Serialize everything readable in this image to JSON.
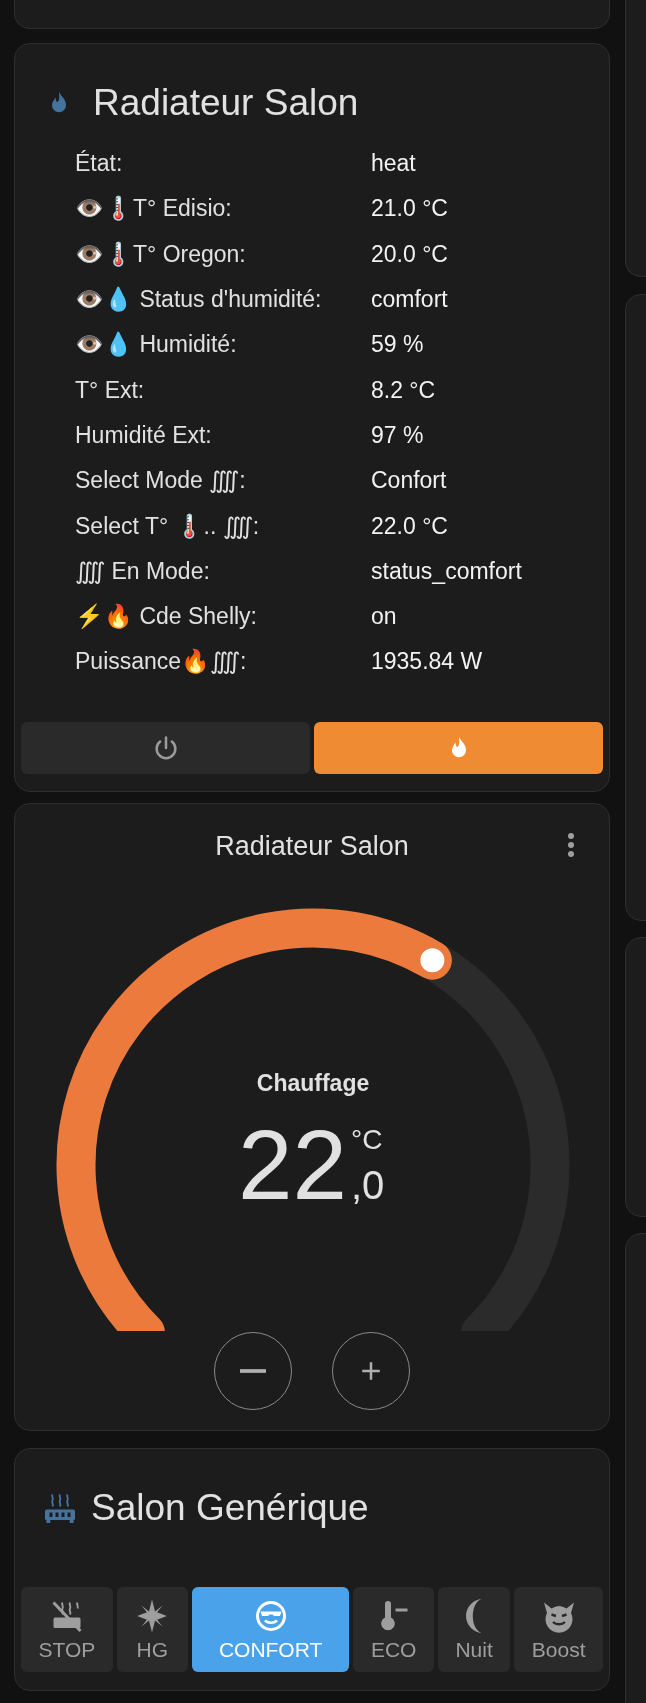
{
  "info_card": {
    "title": "Radiateur Salon",
    "rows": [
      {
        "label": "État:",
        "value": "heat"
      },
      {
        "label": "👁️🌡️T° Edisio:",
        "value": "21.0 °C"
      },
      {
        "label": "👁️🌡️T° Oregon:",
        "value": "20.0 °C"
      },
      {
        "label": "👁️💧 Status d'humidité:",
        "value": "comfort"
      },
      {
        "label": "👁️💧 Humidité:",
        "value": "59 %"
      },
      {
        "label": "T° Ext:",
        "value": "8.2 °C"
      },
      {
        "label": "Humidité Ext:",
        "value": "97 %"
      },
      {
        "label": "Select Mode ⨌:",
        "value": "Confort"
      },
      {
        "label": "Select T° 🌡️.. ⨌:",
        "value": "22.0 °C"
      },
      {
        "label": "⨌ En Mode:",
        "value": "status_comfort"
      },
      {
        "label": "⚡🔥 Cde Shelly:",
        "value": "on"
      },
      {
        "label": "Puissance🔥⨌:",
        "value": "1935.84 W"
      }
    ],
    "hvac_buttons": [
      {
        "kind": "off",
        "selected": false
      },
      {
        "kind": "heat",
        "selected": true
      }
    ]
  },
  "thermostat": {
    "title": "Radiateur Salon",
    "mode": "Chauffage",
    "temperature": "22",
    "decimal": ",0",
    "unit": "°C"
  },
  "preset_card": {
    "title": "Salon Genérique",
    "presets": [
      {
        "kind": "stop",
        "label": "STOP",
        "selected": false
      },
      {
        "kind": "frost",
        "label": "HG",
        "selected": false
      },
      {
        "kind": "comfort",
        "label": "CONFORT",
        "selected": true
      },
      {
        "kind": "eco",
        "label": "ECO",
        "selected": false
      },
      {
        "kind": "night",
        "label": "Nuit",
        "selected": false
      },
      {
        "kind": "boost",
        "label": "Boost",
        "selected": false
      }
    ]
  }
}
